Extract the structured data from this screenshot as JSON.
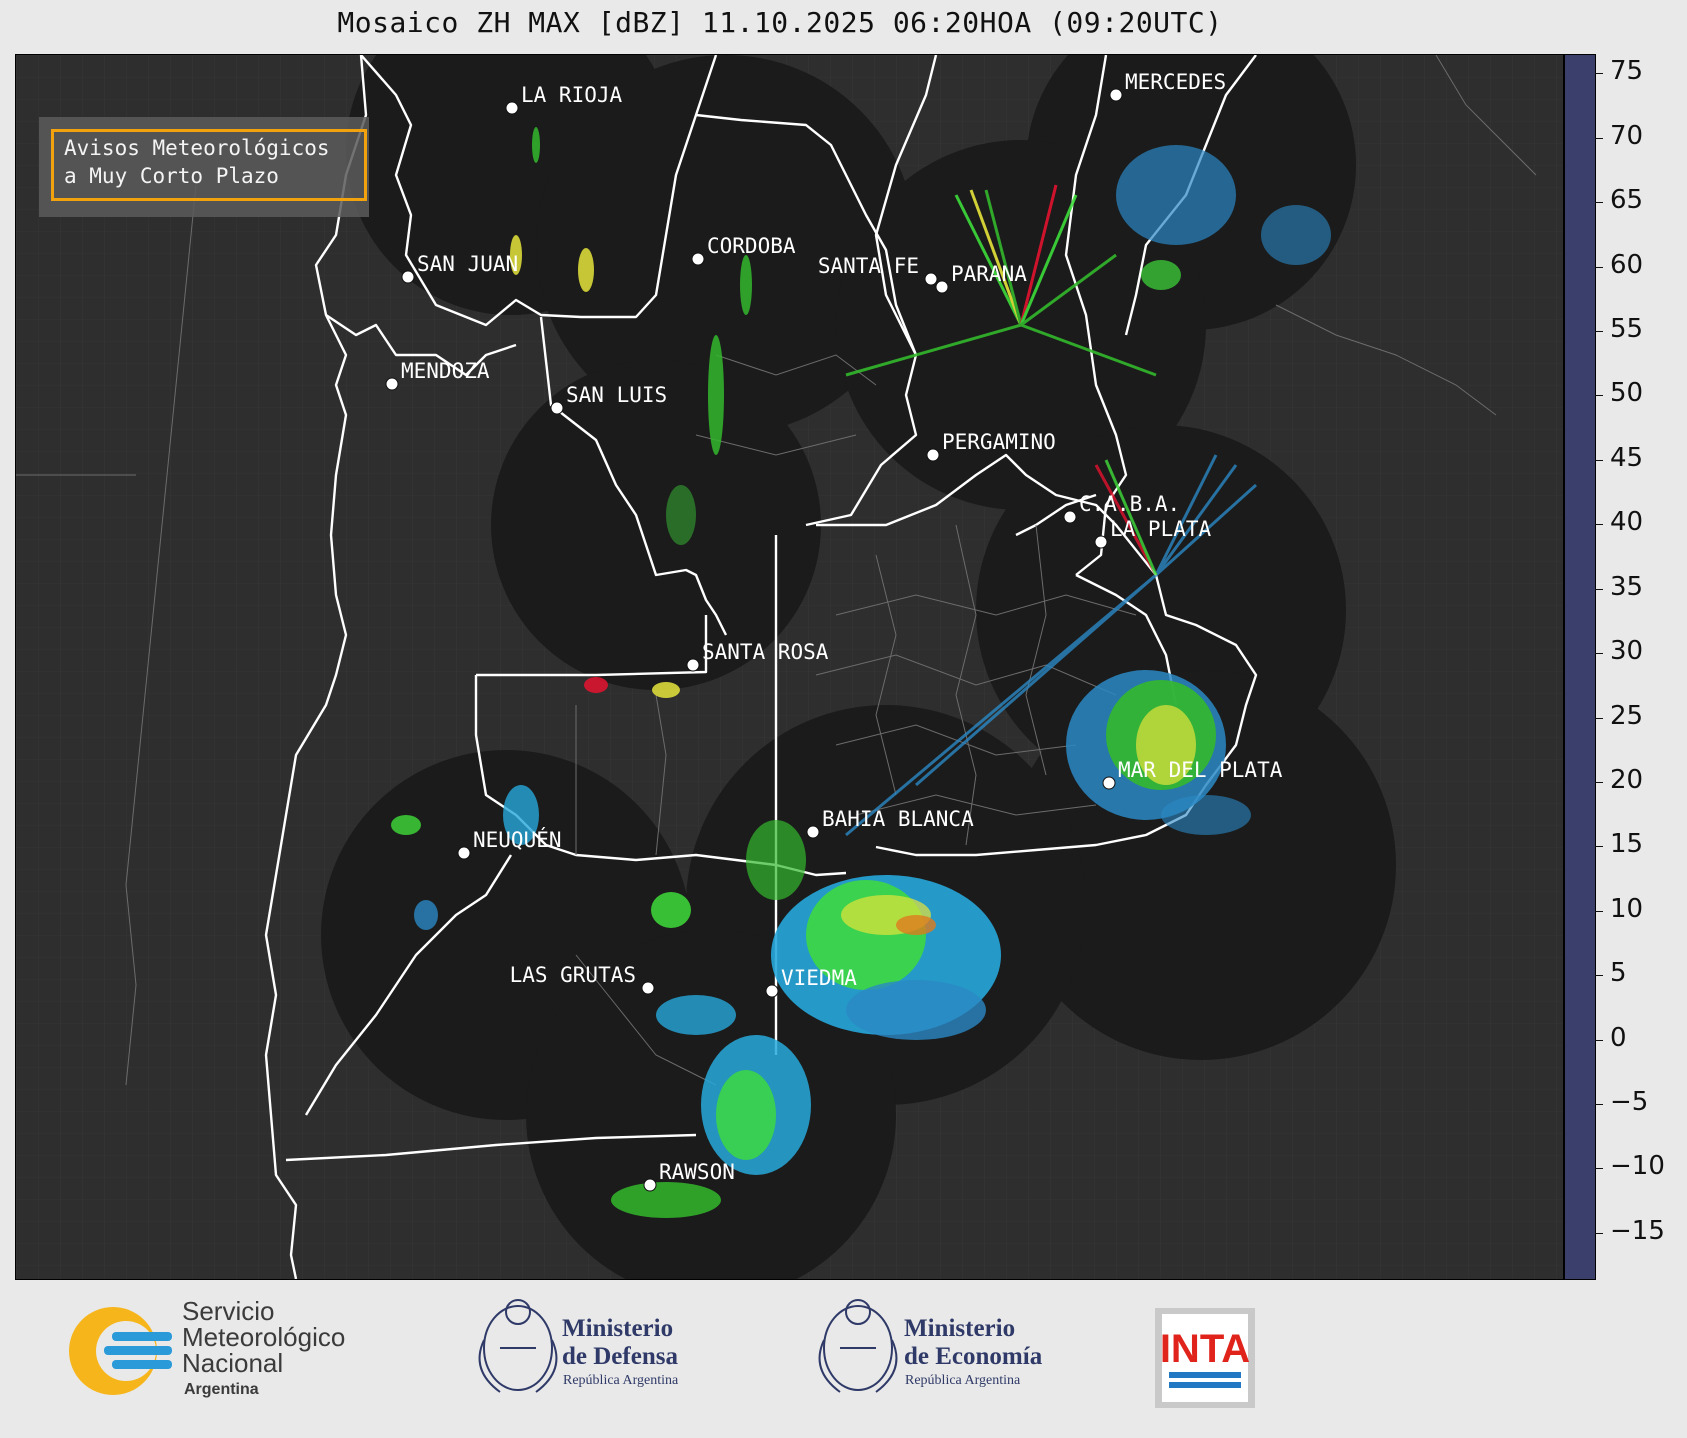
{
  "title": "Mosaico ZH MAX [dBZ] 11.10.2025 06:20HOA (09:20UTC)",
  "notice": {
    "line1": "Avisos Meteorológicos",
    "line2": "a Muy Corto Plazo"
  },
  "cities": [
    {
      "name": "LA RIOJA"
    },
    {
      "name": "MERCEDES"
    },
    {
      "name": "SAN JUAN"
    },
    {
      "name": "CORDOBA"
    },
    {
      "name": "SANTA FE"
    },
    {
      "name": "PARANA"
    },
    {
      "name": "MENDOZA"
    },
    {
      "name": "SAN LUIS"
    },
    {
      "name": "PERGAMINO"
    },
    {
      "name": "C.A.B.A."
    },
    {
      "name": "LA PLATA"
    },
    {
      "name": "SANTA ROSA"
    },
    {
      "name": "MAR DEL PLATA"
    },
    {
      "name": "BAHIA BLANCA"
    },
    {
      "name": "NEUQUÉN"
    },
    {
      "name": "LAS GRUTAS"
    },
    {
      "name": "VIEDMA"
    },
    {
      "name": "RAWSON"
    }
  ],
  "colorbar": {
    "unit": "dBZ",
    "ticks": [
      "75",
      "70",
      "65",
      "60",
      "55",
      "50",
      "45",
      "40",
      "35",
      "30",
      "25",
      "20",
      "15",
      "10",
      "5",
      "0",
      "−5",
      "−10",
      "−15"
    ],
    "range": [
      -18.5,
      76.5
    ],
    "stops": [
      {
        "from": -18.5,
        "to": -15,
        "color": "#3a3f6b"
      },
      {
        "from": -15,
        "to": -10,
        "color": "#3b4677"
      },
      {
        "from": -10,
        "to": -5,
        "color": "#3b4e84"
      },
      {
        "from": -5,
        "to": 0,
        "color": "#3a5690"
      },
      {
        "from": 0,
        "to": 5,
        "color": "#39609d"
      },
      {
        "from": 5,
        "to": 10,
        "color": "#3470ad"
      },
      {
        "from": 10,
        "to": 15,
        "color": "#2a88c4"
      },
      {
        "from": 15,
        "to": 18,
        "color": "#27a9db"
      },
      {
        "from": 18,
        "to": 20,
        "color": "#3edc3a"
      },
      {
        "from": 20,
        "to": 25,
        "color": "#33b82c"
      },
      {
        "from": 25,
        "to": 30,
        "color": "#228020"
      },
      {
        "from": 30,
        "to": 35,
        "color": "#e5e43b"
      },
      {
        "from": 35,
        "to": 40,
        "color": "#c9b229"
      },
      {
        "from": 40,
        "to": 43,
        "color": "#df7b1d"
      },
      {
        "from": 43,
        "to": 47,
        "color": "#e3132e"
      },
      {
        "from": 47,
        "to": 50,
        "color": "#8e0a0a"
      },
      {
        "from": 50,
        "to": 53,
        "color": "#d8006b"
      },
      {
        "from": 53,
        "to": 57,
        "color": "#e400e4"
      },
      {
        "from": 57,
        "to": 59,
        "color": "#9a0090"
      },
      {
        "from": 59,
        "to": 61,
        "color": "#ffffff"
      },
      {
        "from": 61,
        "to": 65,
        "color": "#d9f4ea"
      },
      {
        "from": 65,
        "to": 70,
        "color": "#b6eedb"
      },
      {
        "from": 70,
        "to": 76.5,
        "color": "#8fe0c0"
      }
    ]
  },
  "logos": {
    "smn": {
      "line1": "Servicio",
      "line2": "Meteorológico",
      "line3": "Nacional",
      "line4": "Argentina"
    },
    "defensa": {
      "line1": "Ministerio",
      "line2": "de Defensa",
      "line3": "República Argentina"
    },
    "economia": {
      "line1": "Ministerio",
      "line2": "de Economía",
      "line3": "República Argentina"
    },
    "inta": {
      "label": "INTA"
    }
  },
  "colors": {
    "land": "#1c1c1c",
    "ocean": "#2e2e2e",
    "border": "#ffffff",
    "accent": "#f2a20c"
  }
}
